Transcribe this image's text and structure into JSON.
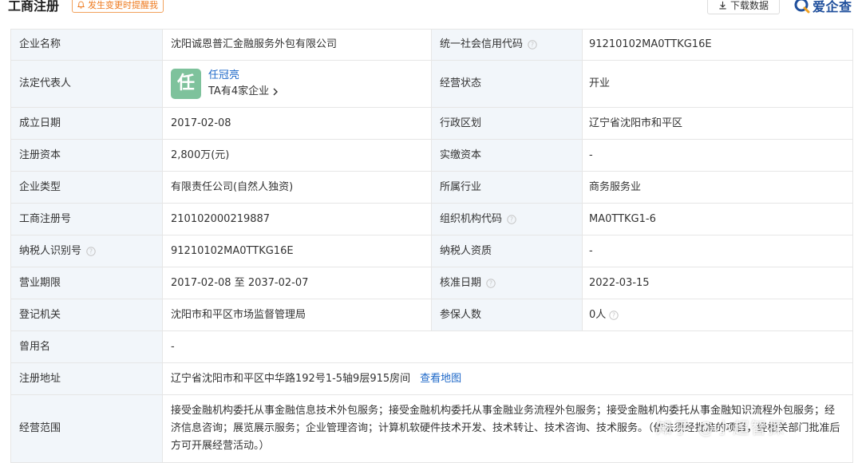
{
  "header": {
    "title": "工商注册",
    "alert_label": "发生变更时提醒我",
    "download_label": "下载数据",
    "brand_name": "爱企查"
  },
  "rows": [
    {
      "label1": "企业名称",
      "value1": "沈阳诚恩普汇金融服务外包有限公司",
      "label2": "统一社会信用代码",
      "value2": "91210102MA0TTKG16E"
    },
    {
      "label1": "法定代表人",
      "label2": "经营状态",
      "value2": "开业"
    },
    {
      "label1": "成立日期",
      "value1": "2017-02-08",
      "label2": "行政区划",
      "value2": "辽宁省沈阳市和平区"
    },
    {
      "label1": "注册资本",
      "value1": "2,800万(元)",
      "label2": "实缴资本",
      "value2": "-"
    },
    {
      "label1": "企业类型",
      "value1": "有限责任公司(自然人独资)",
      "label2": "所属行业",
      "value2": "商务服务业"
    },
    {
      "label1": "工商注册号",
      "value1": "210102000219887",
      "label2": "组织机构代码",
      "value2": "MA0TTKG1-6"
    },
    {
      "label1": "纳税人识别号",
      "value1": "91210102MA0TTKG16E",
      "label2": "纳税人资质",
      "value2": "-"
    },
    {
      "label1": "营业期限",
      "value1": "2017-02-08 至 2037-02-07",
      "label2": "核准日期",
      "value2": "2022-03-15"
    },
    {
      "label1": "登记机关",
      "value1": "沈阳市和平区市场监督管理局",
      "label2": "参保人数",
      "value2": "0人"
    },
    {
      "label1": "曾用名",
      "value1": "-"
    },
    {
      "label1": "注册地址",
      "value1": "辽宁省沈阳市和平区中华路192号1-5轴9层915房间"
    },
    {
      "label1": "经营范围",
      "value1": "接受金融机构委托从事金融信息技术外包服务；接受金融机构委托从事金融业务流程外包服务；接受金融机构委托从事金融知识流程外包服务；经济信息咨询；展览展示服务；企业管理咨询；计算机软硬件技术开发、技术转让、技术咨询、技术服务。（依法须经批准的项目，经相关部门批准后方可开展经营活动。）"
    }
  ],
  "legal_rep": {
    "avatar_char": "任",
    "name": "任冠亮",
    "company_count": "TA有4家企业"
  },
  "map_link": "查看地图",
  "watermark": "知乎 @小超智探",
  "colors": {
    "label_bg": "#f2f6fa",
    "link": "#1e68c8",
    "alert": "#ee7a1f",
    "avatar_bg": "#7ec29c",
    "brand": "#1f4f9c"
  }
}
